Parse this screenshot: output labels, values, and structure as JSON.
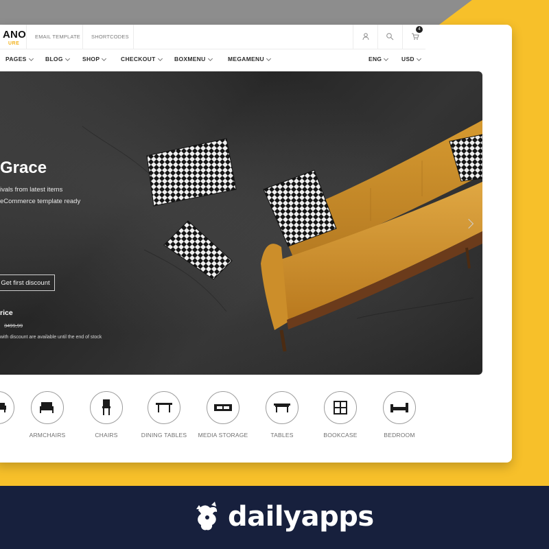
{
  "colors": {
    "accent_yellow": "#f7c02a",
    "header_gray": "#8d8d8d",
    "footer_navy": "#17203d",
    "hero_dark": "#2a2a2a"
  },
  "site": {
    "logo": {
      "main": "ANO",
      "sub": "URE"
    },
    "top_links": [
      "EMAIL TEMPLATE",
      "SHORTCODES"
    ],
    "top_icons": [
      "user-icon",
      "search-icon",
      "cart-icon"
    ],
    "cart_count": "4",
    "nav": [
      "PAGES",
      "BLOG",
      "SHOP",
      "CHECKOUT",
      "BOXMENU",
      "MEGAMENU"
    ],
    "lang": "ENG",
    "currency": "USD"
  },
  "hero": {
    "title": "Grace",
    "line1": "ivals from latest items",
    "line2": "eCommerce template ready",
    "button": "Get first discount",
    "price_label": "rice",
    "old_price": "3499,99",
    "note": "with discount are available until the end of stock"
  },
  "categories": [
    {
      "name": "",
      "icon": "sofa-icon"
    },
    {
      "name": "ARMCHAIRS",
      "icon": "armchair-icon"
    },
    {
      "name": "CHAIRS",
      "icon": "chair-icon"
    },
    {
      "name": "DINING TABLES",
      "icon": "dining-table-icon"
    },
    {
      "name": "MEDIA STORAGE",
      "icon": "media-storage-icon"
    },
    {
      "name": "TABLES",
      "icon": "table-icon"
    },
    {
      "name": "BOOKCASE",
      "icon": "bookcase-icon"
    },
    {
      "name": "BEDROOM",
      "icon": "bed-icon"
    }
  ],
  "footer": {
    "brand": "dailyapps"
  }
}
